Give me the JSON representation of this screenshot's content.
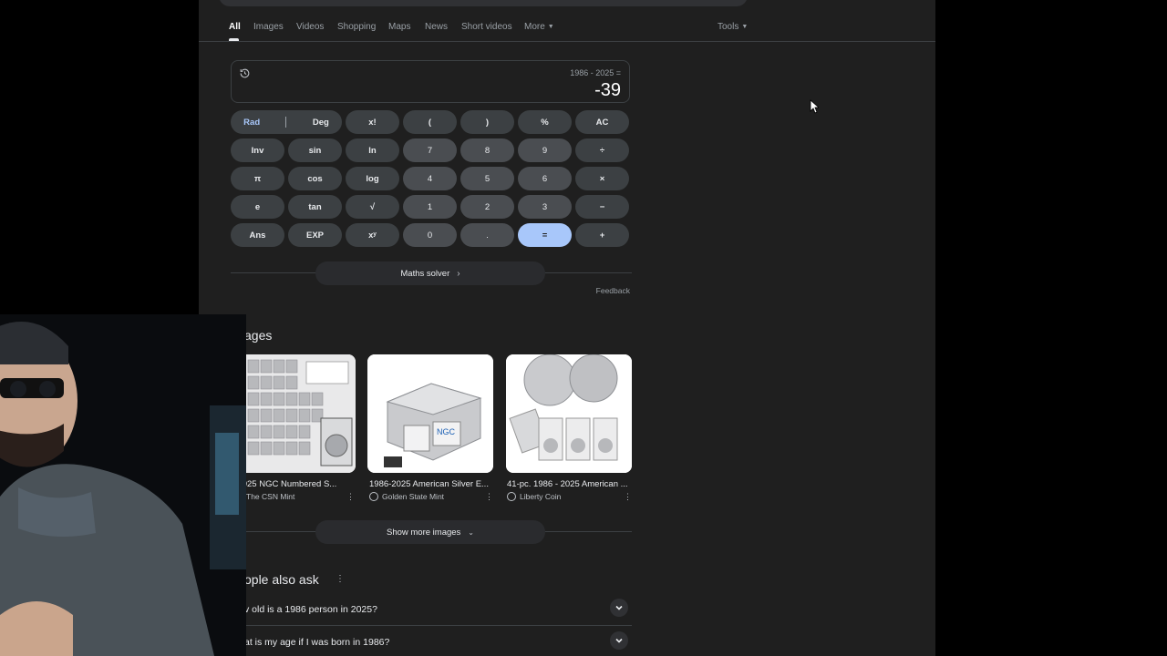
{
  "tabs": [
    {
      "label": "All",
      "active": true
    },
    {
      "label": "Images"
    },
    {
      "label": "Videos"
    },
    {
      "label": "Shopping"
    },
    {
      "label": "Maps"
    },
    {
      "label": "News"
    },
    {
      "label": "Short videos"
    },
    {
      "label": "More"
    }
  ],
  "tools_label": "Tools",
  "calculator": {
    "expression": "1986 - 2025 =",
    "result": "-39",
    "keys": {
      "rad": "Rad",
      "deg": "Deg",
      "fact": "x!",
      "lparen": "(",
      "rparen": ")",
      "percent": "%",
      "ac": "AC",
      "inv": "Inv",
      "sin": "sin",
      "ln": "ln",
      "k7": "7",
      "k8": "8",
      "k9": "9",
      "divide": "÷",
      "pi": "π",
      "cos": "cos",
      "log": "log",
      "k4": "4",
      "k5": "5",
      "k6": "6",
      "multiply": "×",
      "e": "e",
      "tan": "tan",
      "sqrt": "√",
      "k1": "1",
      "k2": "2",
      "k3": "3",
      "minus": "−",
      "ans": "Ans",
      "exp": "EXP",
      "pow": "xʸ",
      "k0": "0",
      "dot": ".",
      "equals": "=",
      "plus": "+"
    },
    "maths_solver": "Maths solver",
    "feedback": "Feedback"
  },
  "images": {
    "title": "ages",
    "cards": [
      {
        "caption": "6-2025 NGC Numbered S...",
        "source": "The CSN Mint"
      },
      {
        "caption": "1986-2025 American Silver E...",
        "source": "Golden State Mint"
      },
      {
        "caption": "41-pc. 1986 - 2025 American ...",
        "source": "Liberty Coin"
      }
    ],
    "show_more": "Show more images"
  },
  "paa": {
    "title": "ople also ask",
    "questions": [
      "v old is a 1986 person in 2025?",
      "at is my age if I was born in 1986?"
    ]
  },
  "colors": {
    "page_bg": "#1f1f1f",
    "accent": "#a8c7fa",
    "key_bg": "#3c4043"
  },
  "icons": [
    "history-icon",
    "chevron-right-icon",
    "chevron-down-icon",
    "more-vert-icon",
    "cursor-icon"
  ]
}
